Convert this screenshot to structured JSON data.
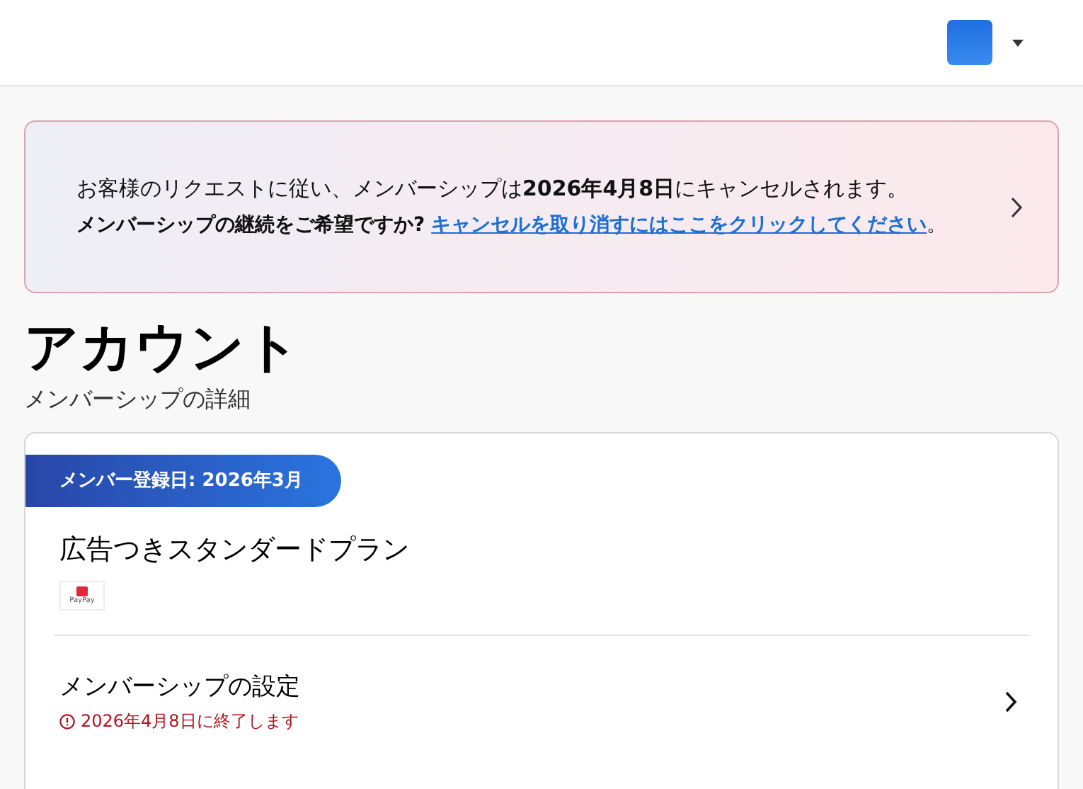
{
  "banner": {
    "line_1": "お客様のリクエストに従い、メンバーシップは**2026年4月8日**にキャンセルされます。",
    "question": "メンバーシップの継続をご希望ですか?",
    "link": "キャンセルを取り消すにはここをクリックしてください",
    "end": "。"
  },
  "page": {
    "title": "アカウント",
    "subtitle": "メンバーシップの詳細"
  },
  "membership_card": {
    "badge": "メンバー登録日: 2026年3月",
    "plan": "広告つきスタンダードプラン",
    "payment_label": "PayPay",
    "settings": {
      "title": "メンバーシップの設定",
      "notice": "2026年4月8日に終了します"
    }
  }
}
